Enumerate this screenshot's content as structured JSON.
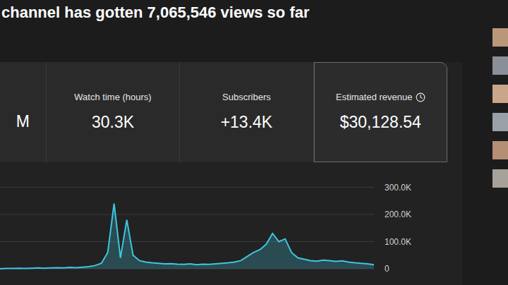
{
  "headline": "channel has gotten 7,065,546 views so far",
  "metrics": [
    {
      "label": "",
      "value": "M",
      "selected": false
    },
    {
      "label": "Watch time (hours)",
      "value": "30.3K",
      "selected": false
    },
    {
      "label": "Subscribers",
      "value": "+13.4K",
      "selected": false
    },
    {
      "label": "Estimated revenue",
      "value": "$30,128.54",
      "selected": true
    }
  ],
  "chart": {
    "ticks": [
      {
        "label": "300.0K",
        "value": 300000
      },
      {
        "label": "200.0K",
        "value": 200000
      },
      {
        "label": "100.0K",
        "value": 100000
      },
      {
        "label": "0",
        "value": 0
      }
    ],
    "series": [
      {
        "name": "views",
        "color": "#3ec6e0",
        "values": [
          0,
          1000,
          1000,
          2000,
          1000,
          2000,
          3000,
          2000,
          3000,
          4000,
          3000,
          5000,
          4000,
          6000,
          8000,
          12000,
          20000,
          60000,
          240000,
          40000,
          180000,
          50000,
          30000,
          25000,
          22000,
          20000,
          18000,
          19000,
          17000,
          16000,
          18000,
          15000,
          17000,
          16000,
          18000,
          20000,
          22000,
          25000,
          30000,
          45000,
          60000,
          70000,
          90000,
          130000,
          100000,
          110000,
          60000,
          40000,
          35000,
          30000,
          28000,
          32000,
          30000,
          27000,
          29000,
          25000,
          22000,
          20000,
          18000,
          15000
        ]
      }
    ]
  }
}
